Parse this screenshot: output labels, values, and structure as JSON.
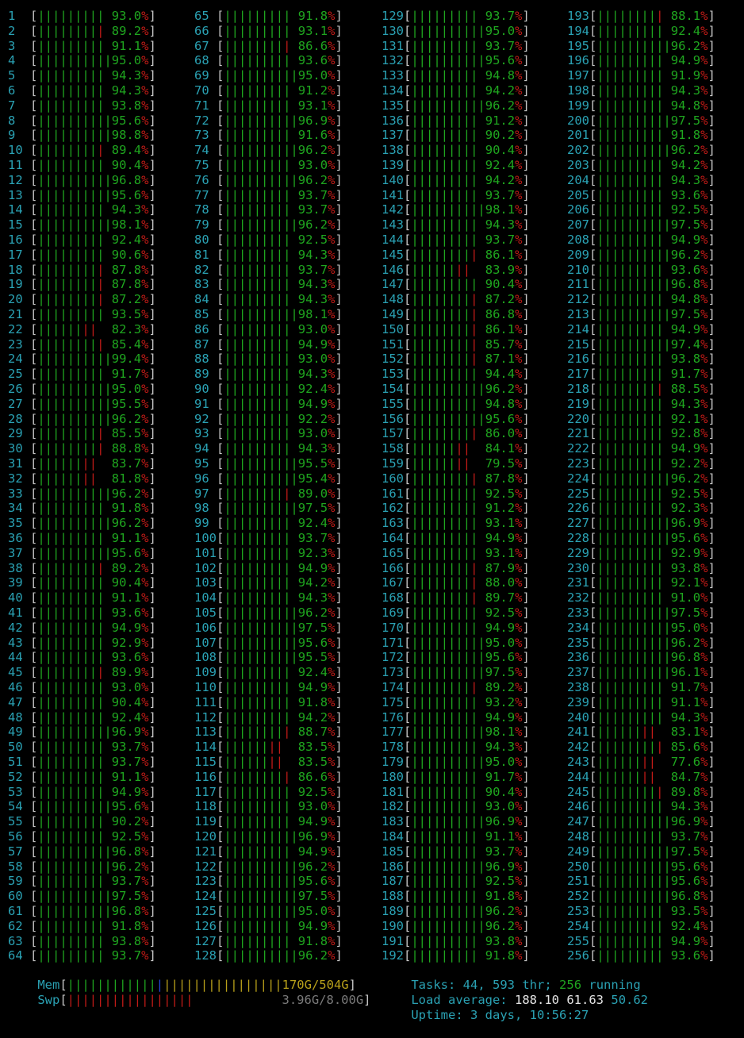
{
  "cpus": [
    {
      "id": "1",
      "pct": "93.0"
    },
    {
      "id": "2",
      "pct": "89.2"
    },
    {
      "id": "3",
      "pct": "91.1"
    },
    {
      "id": "4",
      "pct": "95.0"
    },
    {
      "id": "5",
      "pct": "94.3"
    },
    {
      "id": "6",
      "pct": "94.3"
    },
    {
      "id": "7",
      "pct": "93.8"
    },
    {
      "id": "8",
      "pct": "95.6"
    },
    {
      "id": "9",
      "pct": "98.8"
    },
    {
      "id": "10",
      "pct": "89.4"
    },
    {
      "id": "11",
      "pct": "90.4"
    },
    {
      "id": "12",
      "pct": "96.8"
    },
    {
      "id": "13",
      "pct": "95.6"
    },
    {
      "id": "14",
      "pct": "94.3"
    },
    {
      "id": "15",
      "pct": "98.1"
    },
    {
      "id": "16",
      "pct": "92.4"
    },
    {
      "id": "17",
      "pct": "90.6"
    },
    {
      "id": "18",
      "pct": "87.8"
    },
    {
      "id": "19",
      "pct": "87.8"
    },
    {
      "id": "20",
      "pct": "87.2"
    },
    {
      "id": "21",
      "pct": "93.5"
    },
    {
      "id": "22",
      "pct": "82.3"
    },
    {
      "id": "23",
      "pct": "85.4"
    },
    {
      "id": "24",
      "pct": "99.4"
    },
    {
      "id": "25",
      "pct": "91.7"
    },
    {
      "id": "26",
      "pct": "95.0"
    },
    {
      "id": "27",
      "pct": "95.5"
    },
    {
      "id": "28",
      "pct": "96.2"
    },
    {
      "id": "29",
      "pct": "85.5"
    },
    {
      "id": "30",
      "pct": "88.8"
    },
    {
      "id": "31",
      "pct": "83.7"
    },
    {
      "id": "32",
      "pct": "81.8"
    },
    {
      "id": "33",
      "pct": "96.2"
    },
    {
      "id": "34",
      "pct": "91.8"
    },
    {
      "id": "35",
      "pct": "96.2"
    },
    {
      "id": "36",
      "pct": "91.1"
    },
    {
      "id": "37",
      "pct": "95.6"
    },
    {
      "id": "38",
      "pct": "89.2"
    },
    {
      "id": "39",
      "pct": "90.4"
    },
    {
      "id": "40",
      "pct": "91.1"
    },
    {
      "id": "41",
      "pct": "93.6"
    },
    {
      "id": "42",
      "pct": "94.9"
    },
    {
      "id": "43",
      "pct": "92.9"
    },
    {
      "id": "44",
      "pct": "93.6"
    },
    {
      "id": "45",
      "pct": "89.9"
    },
    {
      "id": "46",
      "pct": "93.0"
    },
    {
      "id": "47",
      "pct": "90.4"
    },
    {
      "id": "48",
      "pct": "92.4"
    },
    {
      "id": "49",
      "pct": "96.9"
    },
    {
      "id": "50",
      "pct": "93.7"
    },
    {
      "id": "51",
      "pct": "93.7"
    },
    {
      "id": "52",
      "pct": "91.1"
    },
    {
      "id": "53",
      "pct": "94.9"
    },
    {
      "id": "54",
      "pct": "95.6"
    },
    {
      "id": "55",
      "pct": "90.2"
    },
    {
      "id": "56",
      "pct": "92.5"
    },
    {
      "id": "57",
      "pct": "96.8"
    },
    {
      "id": "58",
      "pct": "96.2"
    },
    {
      "id": "59",
      "pct": "93.7"
    },
    {
      "id": "60",
      "pct": "97.5"
    },
    {
      "id": "61",
      "pct": "96.8"
    },
    {
      "id": "62",
      "pct": "91.8"
    },
    {
      "id": "63",
      "pct": "93.8"
    },
    {
      "id": "64",
      "pct": "93.7"
    },
    {
      "id": "65",
      "pct": "91.8"
    },
    {
      "id": "66",
      "pct": "93.1"
    },
    {
      "id": "67",
      "pct": "86.6"
    },
    {
      "id": "68",
      "pct": "93.6"
    },
    {
      "id": "69",
      "pct": "95.0"
    },
    {
      "id": "70",
      "pct": "91.2"
    },
    {
      "id": "71",
      "pct": "93.1"
    },
    {
      "id": "72",
      "pct": "96.9"
    },
    {
      "id": "73",
      "pct": "91.6"
    },
    {
      "id": "74",
      "pct": "96.2"
    },
    {
      "id": "75",
      "pct": "93.0"
    },
    {
      "id": "76",
      "pct": "96.2"
    },
    {
      "id": "77",
      "pct": "93.7"
    },
    {
      "id": "78",
      "pct": "93.7"
    },
    {
      "id": "79",
      "pct": "96.2"
    },
    {
      "id": "80",
      "pct": "92.5"
    },
    {
      "id": "81",
      "pct": "94.3"
    },
    {
      "id": "82",
      "pct": "93.7"
    },
    {
      "id": "83",
      "pct": "94.3"
    },
    {
      "id": "84",
      "pct": "94.3"
    },
    {
      "id": "85",
      "pct": "98.1"
    },
    {
      "id": "86",
      "pct": "93.0"
    },
    {
      "id": "87",
      "pct": "94.9"
    },
    {
      "id": "88",
      "pct": "93.0"
    },
    {
      "id": "89",
      "pct": "94.3"
    },
    {
      "id": "90",
      "pct": "92.4"
    },
    {
      "id": "91",
      "pct": "94.9"
    },
    {
      "id": "92",
      "pct": "92.2"
    },
    {
      "id": "93",
      "pct": "93.0"
    },
    {
      "id": "94",
      "pct": "94.3"
    },
    {
      "id": "95",
      "pct": "95.5"
    },
    {
      "id": "96",
      "pct": "95.4"
    },
    {
      "id": "97",
      "pct": "89.0"
    },
    {
      "id": "98",
      "pct": "97.5"
    },
    {
      "id": "99",
      "pct": "92.4"
    },
    {
      "id": "100",
      "pct": "93.7"
    },
    {
      "id": "101",
      "pct": "92.3"
    },
    {
      "id": "102",
      "pct": "94.9"
    },
    {
      "id": "103",
      "pct": "94.2"
    },
    {
      "id": "104",
      "pct": "94.3"
    },
    {
      "id": "105",
      "pct": "96.2"
    },
    {
      "id": "106",
      "pct": "97.5"
    },
    {
      "id": "107",
      "pct": "95.6"
    },
    {
      "id": "108",
      "pct": "95.5"
    },
    {
      "id": "109",
      "pct": "92.4"
    },
    {
      "id": "110",
      "pct": "94.9"
    },
    {
      "id": "111",
      "pct": "91.8"
    },
    {
      "id": "112",
      "pct": "94.2"
    },
    {
      "id": "113",
      "pct": "88.7"
    },
    {
      "id": "114",
      "pct": "83.5"
    },
    {
      "id": "115",
      "pct": "83.5"
    },
    {
      "id": "116",
      "pct": "86.6"
    },
    {
      "id": "117",
      "pct": "92.5"
    },
    {
      "id": "118",
      "pct": "93.0"
    },
    {
      "id": "119",
      "pct": "94.9"
    },
    {
      "id": "120",
      "pct": "96.9"
    },
    {
      "id": "121",
      "pct": "94.9"
    },
    {
      "id": "122",
      "pct": "96.2"
    },
    {
      "id": "123",
      "pct": "95.6"
    },
    {
      "id": "124",
      "pct": "97.5"
    },
    {
      "id": "125",
      "pct": "95.0"
    },
    {
      "id": "126",
      "pct": "94.9"
    },
    {
      "id": "127",
      "pct": "91.8"
    },
    {
      "id": "128",
      "pct": "96.2"
    },
    {
      "id": "129",
      "pct": "93.7"
    },
    {
      "id": "130",
      "pct": "95.0"
    },
    {
      "id": "131",
      "pct": "93.7"
    },
    {
      "id": "132",
      "pct": "95.6"
    },
    {
      "id": "133",
      "pct": "94.8"
    },
    {
      "id": "134",
      "pct": "94.2"
    },
    {
      "id": "135",
      "pct": "96.2"
    },
    {
      "id": "136",
      "pct": "91.2"
    },
    {
      "id": "137",
      "pct": "90.2"
    },
    {
      "id": "138",
      "pct": "90.4"
    },
    {
      "id": "139",
      "pct": "92.4"
    },
    {
      "id": "140",
      "pct": "94.2"
    },
    {
      "id": "141",
      "pct": "93.7"
    },
    {
      "id": "142",
      "pct": "98.1"
    },
    {
      "id": "143",
      "pct": "94.3"
    },
    {
      "id": "144",
      "pct": "93.7"
    },
    {
      "id": "145",
      "pct": "86.1"
    },
    {
      "id": "146",
      "pct": "83.9"
    },
    {
      "id": "147",
      "pct": "90.4"
    },
    {
      "id": "148",
      "pct": "87.2"
    },
    {
      "id": "149",
      "pct": "86.8"
    },
    {
      "id": "150",
      "pct": "86.1"
    },
    {
      "id": "151",
      "pct": "85.7"
    },
    {
      "id": "152",
      "pct": "87.1"
    },
    {
      "id": "153",
      "pct": "94.4"
    },
    {
      "id": "154",
      "pct": "96.2"
    },
    {
      "id": "155",
      "pct": "94.8"
    },
    {
      "id": "156",
      "pct": "95.6"
    },
    {
      "id": "157",
      "pct": "86.0"
    },
    {
      "id": "158",
      "pct": "84.1"
    },
    {
      "id": "159",
      "pct": "79.5"
    },
    {
      "id": "160",
      "pct": "87.8"
    },
    {
      "id": "161",
      "pct": "92.5"
    },
    {
      "id": "162",
      "pct": "91.2"
    },
    {
      "id": "163",
      "pct": "93.1"
    },
    {
      "id": "164",
      "pct": "94.9"
    },
    {
      "id": "165",
      "pct": "93.1"
    },
    {
      "id": "166",
      "pct": "87.9"
    },
    {
      "id": "167",
      "pct": "88.0"
    },
    {
      "id": "168",
      "pct": "89.7"
    },
    {
      "id": "169",
      "pct": "92.5"
    },
    {
      "id": "170",
      "pct": "94.9"
    },
    {
      "id": "171",
      "pct": "95.0"
    },
    {
      "id": "172",
      "pct": "95.6"
    },
    {
      "id": "173",
      "pct": "97.5"
    },
    {
      "id": "174",
      "pct": "89.2"
    },
    {
      "id": "175",
      "pct": "93.2"
    },
    {
      "id": "176",
      "pct": "94.9"
    },
    {
      "id": "177",
      "pct": "98.1"
    },
    {
      "id": "178",
      "pct": "94.3"
    },
    {
      "id": "179",
      "pct": "95.0"
    },
    {
      "id": "180",
      "pct": "91.7"
    },
    {
      "id": "181",
      "pct": "90.4"
    },
    {
      "id": "182",
      "pct": "93.0"
    },
    {
      "id": "183",
      "pct": "96.9"
    },
    {
      "id": "184",
      "pct": "91.1"
    },
    {
      "id": "185",
      "pct": "93.7"
    },
    {
      "id": "186",
      "pct": "96.9"
    },
    {
      "id": "187",
      "pct": "92.5"
    },
    {
      "id": "188",
      "pct": "91.8"
    },
    {
      "id": "189",
      "pct": "96.2"
    },
    {
      "id": "190",
      "pct": "96.2"
    },
    {
      "id": "191",
      "pct": "93.8"
    },
    {
      "id": "192",
      "pct": "91.8"
    },
    {
      "id": "193",
      "pct": "88.1"
    },
    {
      "id": "194",
      "pct": "92.4"
    },
    {
      "id": "195",
      "pct": "96.2"
    },
    {
      "id": "196",
      "pct": "94.9"
    },
    {
      "id": "197",
      "pct": "91.9"
    },
    {
      "id": "198",
      "pct": "94.3"
    },
    {
      "id": "199",
      "pct": "94.8"
    },
    {
      "id": "200",
      "pct": "97.5"
    },
    {
      "id": "201",
      "pct": "91.8"
    },
    {
      "id": "202",
      "pct": "96.2"
    },
    {
      "id": "203",
      "pct": "94.2"
    },
    {
      "id": "204",
      "pct": "94.3"
    },
    {
      "id": "205",
      "pct": "93.6"
    },
    {
      "id": "206",
      "pct": "92.5"
    },
    {
      "id": "207",
      "pct": "97.5"
    },
    {
      "id": "208",
      "pct": "94.9"
    },
    {
      "id": "209",
      "pct": "96.2"
    },
    {
      "id": "210",
      "pct": "93.6"
    },
    {
      "id": "211",
      "pct": "96.8"
    },
    {
      "id": "212",
      "pct": "94.8"
    },
    {
      "id": "213",
      "pct": "97.5"
    },
    {
      "id": "214",
      "pct": "94.9"
    },
    {
      "id": "215",
      "pct": "97.4"
    },
    {
      "id": "216",
      "pct": "93.8"
    },
    {
      "id": "217",
      "pct": "91.7"
    },
    {
      "id": "218",
      "pct": "88.5"
    },
    {
      "id": "219",
      "pct": "94.3"
    },
    {
      "id": "220",
      "pct": "92.1"
    },
    {
      "id": "221",
      "pct": "92.8"
    },
    {
      "id": "222",
      "pct": "94.9"
    },
    {
      "id": "223",
      "pct": "92.2"
    },
    {
      "id": "224",
      "pct": "96.2"
    },
    {
      "id": "225",
      "pct": "92.5"
    },
    {
      "id": "226",
      "pct": "92.3"
    },
    {
      "id": "227",
      "pct": "96.9"
    },
    {
      "id": "228",
      "pct": "95.6"
    },
    {
      "id": "229",
      "pct": "92.9"
    },
    {
      "id": "230",
      "pct": "93.8"
    },
    {
      "id": "231",
      "pct": "92.1"
    },
    {
      "id": "232",
      "pct": "91.0"
    },
    {
      "id": "233",
      "pct": "97.5"
    },
    {
      "id": "234",
      "pct": "95.0"
    },
    {
      "id": "235",
      "pct": "96.2"
    },
    {
      "id": "236",
      "pct": "96.8"
    },
    {
      "id": "237",
      "pct": "96.1"
    },
    {
      "id": "238",
      "pct": "91.7"
    },
    {
      "id": "239",
      "pct": "91.1"
    },
    {
      "id": "240",
      "pct": "94.3"
    },
    {
      "id": "241",
      "pct": "83.1"
    },
    {
      "id": "242",
      "pct": "85.6"
    },
    {
      "id": "243",
      "pct": "77.6"
    },
    {
      "id": "244",
      "pct": "84.7"
    },
    {
      "id": "245",
      "pct": "89.8"
    },
    {
      "id": "246",
      "pct": "94.3"
    },
    {
      "id": "247",
      "pct": "96.9"
    },
    {
      "id": "248",
      "pct": "93.7"
    },
    {
      "id": "249",
      "pct": "97.5"
    },
    {
      "id": "250",
      "pct": "95.6"
    },
    {
      "id": "251",
      "pct": "95.6"
    },
    {
      "id": "252",
      "pct": "96.8"
    },
    {
      "id": "253",
      "pct": "93.5"
    },
    {
      "id": "254",
      "pct": "92.4"
    },
    {
      "id": "255",
      "pct": "94.9"
    },
    {
      "id": "256",
      "pct": "93.6"
    }
  ],
  "mem": {
    "label": "Mem",
    "value": "170G/504G",
    "used_fraction": 0.337
  },
  "swp": {
    "label": "Swp",
    "value": "3.96G/8.00G",
    "used_fraction": 0.495
  },
  "tasks": {
    "label": "Tasks:",
    "count": "44,",
    "thr": "593",
    "thr_label": "thr;",
    "running": "256",
    "running_label": "running"
  },
  "load": {
    "label": "Load average:",
    "l1": "188.10",
    "l5": "61.63",
    "l15": "50.62"
  },
  "uptime": {
    "label": "Uptime:",
    "value": "3 days, 10:56:27"
  },
  "colors": {
    "green": "#1fa51f",
    "red": "#c11b17",
    "blue": "#2546d8",
    "yellow": "#b8a01a",
    "cyan": "#2aa1b3"
  }
}
